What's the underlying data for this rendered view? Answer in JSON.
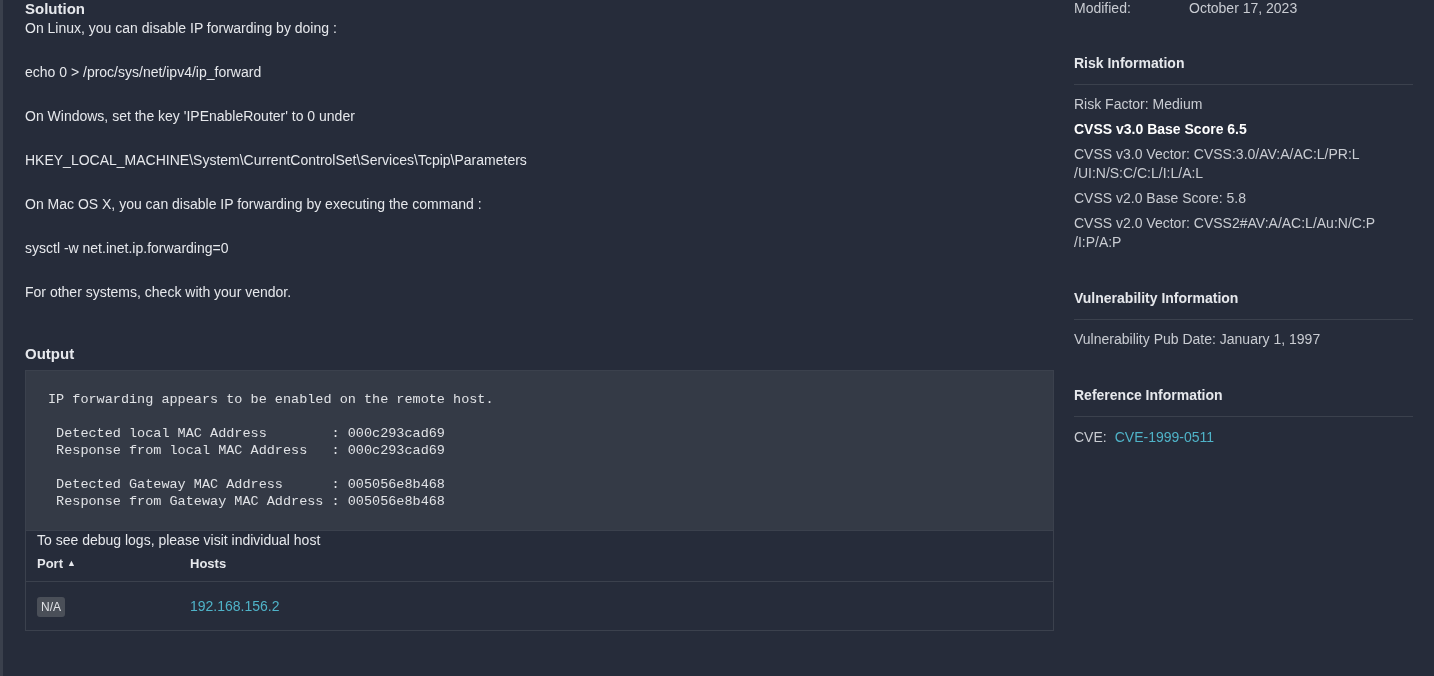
{
  "solution": {
    "title": "Solution",
    "paragraphs": [
      "On Linux, you can disable IP forwarding by doing :",
      "echo 0 > /proc/sys/net/ipv4/ip_forward",
      "On Windows, set the key 'IPEnableRouter' to 0 under",
      "HKEY_LOCAL_MACHINE\\System\\CurrentControlSet\\Services\\Tcpip\\Parameters",
      "On Mac OS X, you can disable IP forwarding by executing the command :",
      "sysctl -w net.inet.ip.forwarding=0",
      "For other systems, check with your vendor."
    ]
  },
  "output": {
    "title": "Output",
    "blocks": [
      [
        "IP forwarding appears to be enabled on the remote host."
      ],
      [
        " Detected local MAC Address        : 000c293cad69",
        " Response from local MAC Address   : 000c293cad69"
      ],
      [
        " Detected Gateway MAC Address      : 005056e8b468",
        " Response from Gateway MAC Address : 005056e8b468"
      ]
    ],
    "debug_note": "To see debug logs, please visit individual host",
    "table": {
      "columns": [
        {
          "label": "Port",
          "sort": "▲"
        },
        {
          "label": "Hosts"
        }
      ],
      "rows": [
        {
          "port": "N/A",
          "host": "192.168.156.2"
        }
      ]
    }
  },
  "modified": {
    "label": "Modified:",
    "value": "October 17, 2023"
  },
  "sections": [
    {
      "title": "Risk Information",
      "items": [
        {
          "text": "Risk Factor: Medium",
          "bold": false
        },
        {
          "text": "CVSS v3.0 Base Score 6.5",
          "bold": true
        },
        {
          "text": "CVSS v3.0 Vector: CVSS:3.0/AV:A/AC:L/PR:L\n/UI:N/S:C/C:L/I:L/A:L",
          "bold": false
        },
        {
          "text": "CVSS v2.0 Base Score: 5.8",
          "bold": false
        },
        {
          "text": "CVSS v2.0 Vector: CVSS2#AV:A/AC:L/Au:N/C:P\n/I:P/A:P",
          "bold": false
        }
      ]
    },
    {
      "title": "Vulnerability Information",
      "items": [
        {
          "text": "Vulnerability Pub Date: January 1, 1997",
          "bold": false
        }
      ]
    },
    {
      "title": "Reference Information",
      "refs": [
        {
          "label": "CVE:",
          "link": "CVE-1999-0511"
        }
      ]
    }
  ]
}
